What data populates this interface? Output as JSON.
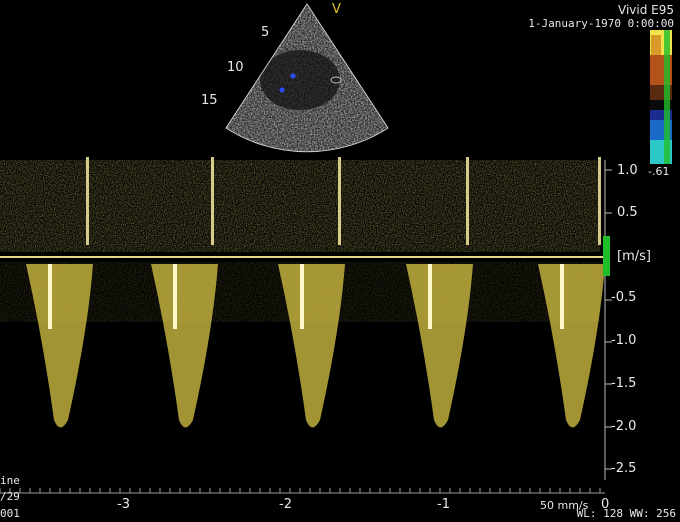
{
  "header": {
    "device": "Vivid E95",
    "datetime": "1-January-1970 0:00:00"
  },
  "sector": {
    "probe_mark": "V",
    "depth_labels": [
      "5",
      "10",
      "15"
    ]
  },
  "velocity_scale": {
    "unit": "[m/s]",
    "ticks": [
      "1.0",
      "0.5",
      "-0.5",
      "-1.0",
      "-1.5",
      "-2.0",
      "-2.5"
    ]
  },
  "colorbar": {
    "label": "-.61"
  },
  "time_axis": {
    "ticks": [
      "-3",
      "-2",
      "-1",
      "0"
    ],
    "sweep": "50 mm/s"
  },
  "footer": {
    "left_line1": "ine",
    "left_line2": "/29",
    "left_line3": "001",
    "window": "WL: 128  WW: 256"
  },
  "colors": {
    "doppler": "#e7d14a",
    "baseline": "#e6d98a",
    "indicator": "#1fbf2a"
  }
}
